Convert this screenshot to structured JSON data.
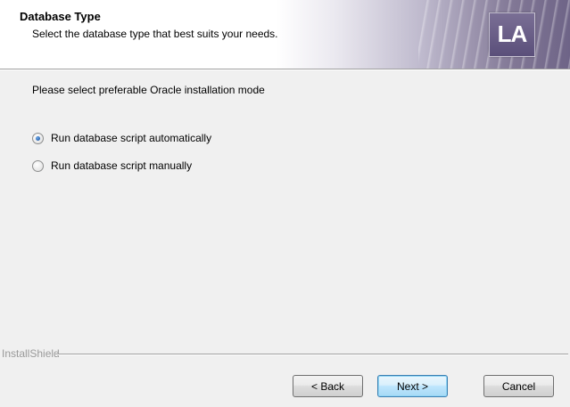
{
  "header": {
    "title": "Database Type",
    "subtitle": "Select the database type that best suits your needs.",
    "logo_text": "LA"
  },
  "main": {
    "instruction": "Please select preferable Oracle installation mode",
    "options": [
      {
        "label": "Run database script automatically",
        "selected": true
      },
      {
        "label": "Run database script manually",
        "selected": false
      }
    ]
  },
  "footer": {
    "brand": "InstallShield",
    "back_label": "< Back",
    "next_label": "Next >",
    "cancel_label": "Cancel"
  }
}
